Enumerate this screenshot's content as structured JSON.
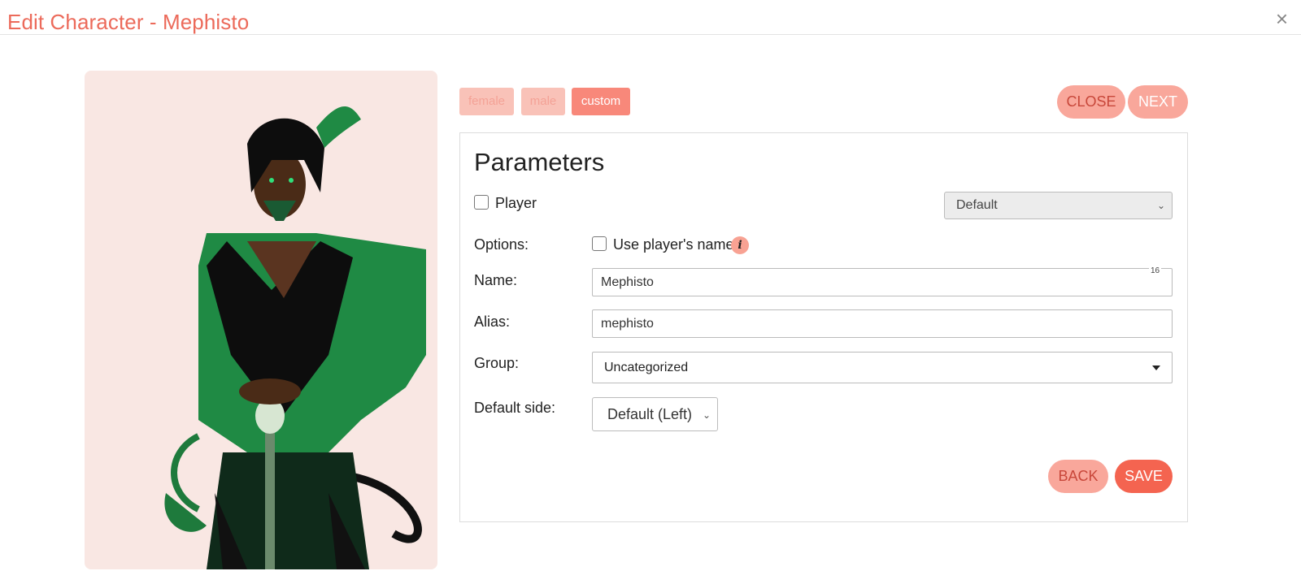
{
  "header": {
    "title": "Edit Character - Mephisto",
    "close_glyph": "×"
  },
  "portrait": {
    "alt": "Character portrait of Mephisto, a horned demon in a green coat holding a cane",
    "background": "#f9e7e3"
  },
  "presets": {
    "female": "female",
    "male": "male",
    "custom": "custom"
  },
  "nav": {
    "close_label": "CLOSE",
    "next_label": "NEXT",
    "back_label": "BACK",
    "save_label": "SAVE"
  },
  "parameters": {
    "title": "Parameters",
    "player_label": "Player",
    "player_checked": false,
    "preset_select_value": "Default",
    "options_label": "Options:",
    "use_player_name_label": "Use player's name",
    "use_player_name_checked": false,
    "info_glyph": "i",
    "name_label": "Name:",
    "name_value": "Mephisto",
    "name_counter": "16",
    "alias_label": "Alias:",
    "alias_value": "mephisto",
    "group_label": "Group:",
    "group_value": "Uncategorized",
    "default_side_label": "Default side:",
    "default_side_value": "Default (Left)"
  },
  "colors": {
    "accent": "#ec6a5a",
    "button_light": "#f9a79b",
    "button_dark": "#f46450"
  }
}
